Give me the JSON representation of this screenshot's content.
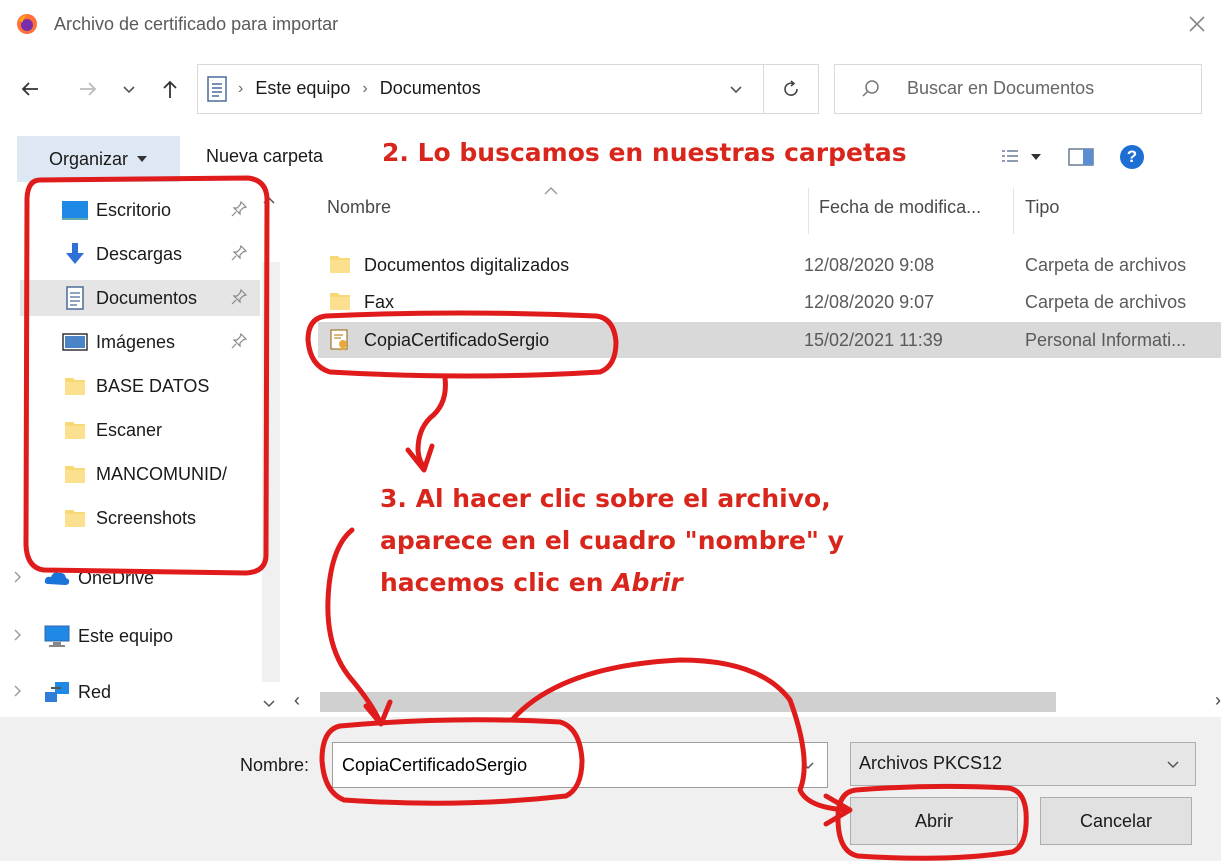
{
  "window": {
    "title": "Archivo de certificado para importar",
    "app_icon": "firefox-icon",
    "close_icon": "close-icon"
  },
  "nav": {
    "back_icon": "arrow-left-icon",
    "forward_icon": "arrow-right-icon",
    "recent_icon": "chevron-down-icon",
    "up_icon": "arrow-up-icon",
    "breadcrumbs": [
      "Este equipo",
      "Documentos"
    ],
    "refresh_icon": "refresh-icon",
    "search_placeholder": "Buscar en Documentos"
  },
  "toolbar": {
    "organize_label": "Organizar",
    "new_folder_label": "Nueva carpeta",
    "annotation_step2": "2. Lo buscamos en nuestras carpetas"
  },
  "sidebar": {
    "items": [
      {
        "label": "Escritorio",
        "icon": "desktop-icon",
        "pinned": true
      },
      {
        "label": "Descargas",
        "icon": "download-icon",
        "pinned": true
      },
      {
        "label": "Documentos",
        "icon": "document-icon",
        "pinned": true,
        "selected": true
      },
      {
        "label": "Imágenes",
        "icon": "image-icon",
        "pinned": true
      },
      {
        "label": "BASE DATOS",
        "icon": "folder-icon"
      },
      {
        "label": "Escaner",
        "icon": "folder-icon"
      },
      {
        "label": "MANCOMUNID/",
        "icon": "folder-icon"
      },
      {
        "label": "Screenshots",
        "icon": "folder-icon"
      },
      {
        "label": "OneDrive",
        "icon": "onedrive-icon"
      },
      {
        "label": "Este equipo",
        "icon": "computer-icon"
      },
      {
        "label": "Red",
        "icon": "network-icon"
      }
    ]
  },
  "columns": {
    "name": "Nombre",
    "date": "Fecha de modifica...",
    "type": "Tipo"
  },
  "files": [
    {
      "name": "Documentos digitalizados",
      "date": "12/08/2020 9:08",
      "type": "Carpeta de archivos",
      "icon": "folder-icon"
    },
    {
      "name": "Fax",
      "date": "12/08/2020 9:07",
      "type": "Carpeta de archivos",
      "icon": "folder-icon"
    },
    {
      "name": "CopiaCertificadoSergio",
      "date": "15/02/2021 11:39",
      "type": "Personal Informati...",
      "icon": "certificate-icon",
      "selected": true
    }
  ],
  "footer": {
    "name_label": "Nombre:",
    "name_value": "CopiaCertificadoSergio",
    "filter_value": "Archivos PKCS12",
    "open_label": "Abrir",
    "cancel_label": "Cancelar"
  },
  "annotation_step3": {
    "line1": "3. Al hacer clic sobre el archivo,",
    "line2": "aparece en el cuadro \"nombre\" y",
    "line3_prefix": "hacemos clic en ",
    "line3_emph": "Abrir"
  },
  "colors": {
    "annotation": "#e01b1b",
    "selection": "#d9d9d9",
    "organize_bg": "#dde8f4"
  }
}
